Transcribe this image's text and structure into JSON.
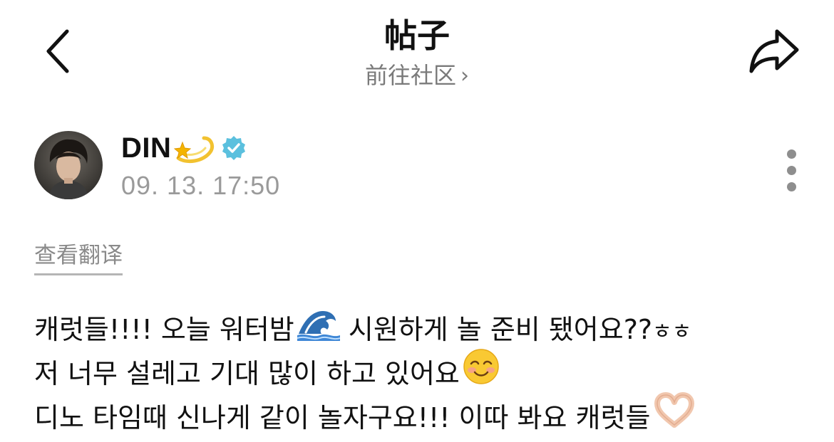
{
  "header": {
    "title": "帖子",
    "community_link": "前往社区",
    "back_icon": "chevron-left-icon",
    "share_icon": "share-arrow-icon"
  },
  "author": {
    "name": "DIN",
    "name_emoji": "dizzy-emoji",
    "verified_icon": "verified-badge-icon",
    "verified_color": "#5bc0de",
    "timestamp": "09. 13. 17:50",
    "more_icon": "more-vertical-icon"
  },
  "translate_label": "查看翻译",
  "content": {
    "line1_part1": "캐럿들!!!! 오늘 워터밤",
    "line1_emoji": "water-wave-emoji",
    "line1_part2": " 시원하게 놀 준비 됐어요??",
    "line1_suffix": "ㅎㅎ",
    "line2_text": "저 너무 설레고 기대 많이 하고 있어요",
    "line2_emoji": "smiling-face-emoji",
    "line3_text": "디노 타임때 신나게 같이 놀자구요!!! 이따 봐요 캐럿들",
    "line3_emoji": "heart-hands-emoji"
  }
}
